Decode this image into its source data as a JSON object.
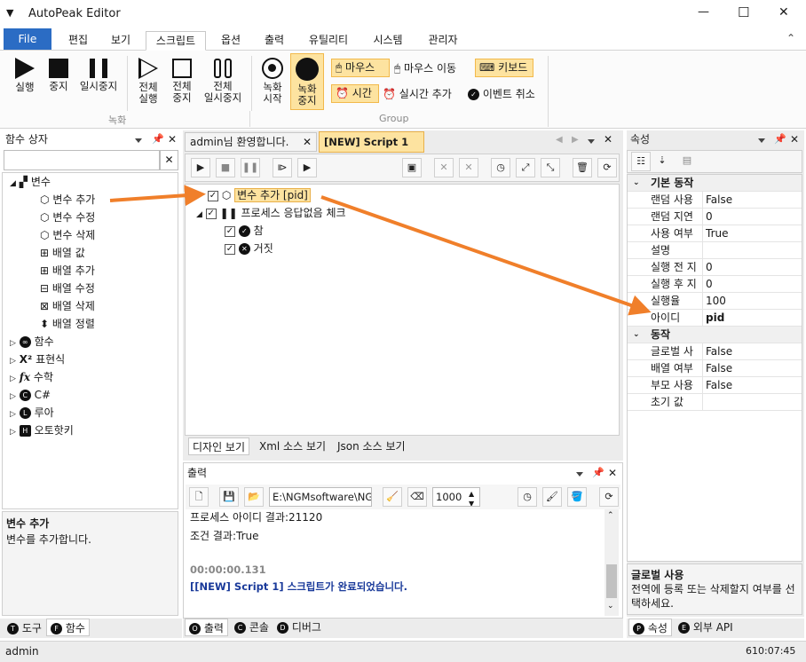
{
  "window": {
    "title": "AutoPeak Editor",
    "min": "—",
    "max": "☐",
    "close": "✕"
  },
  "menu": {
    "file": "File",
    "tabs": [
      "편집",
      "보기",
      "스크립트",
      "옵션",
      "출력",
      "유틸리티",
      "시스템",
      "관리자"
    ],
    "collapse": "⌃"
  },
  "ribbon": {
    "run": "실행",
    "stop": "중지",
    "pause": "일시중지",
    "run_all": [
      "전체",
      "실행"
    ],
    "stop_all": [
      "전체",
      "중지"
    ],
    "pause_all": [
      "전체",
      "일시중지"
    ],
    "rec_start": [
      "녹화",
      "시작"
    ],
    "rec_stop": [
      "녹화",
      "중지"
    ],
    "mouse": "마우스",
    "mouse_move": "마우스 이동",
    "keyboard": "키보드",
    "time": "시간",
    "realtime_add": "실시간 추가",
    "event_cancel": "이벤트 취소",
    "group_rec": "녹화",
    "group_group": "Group"
  },
  "left": {
    "header": "함수 상자",
    "search_value": "",
    "clear": "✕",
    "tree": {
      "var": "변수",
      "var_children": [
        "변수 추가",
        "변수 수정",
        "변수 삭제",
        "배열 값",
        "배열 추가",
        "배열 수정",
        "배열 삭제",
        "배열 정렬"
      ],
      "others": [
        "함수",
        "표현식",
        "수학",
        "C#",
        "루아",
        "오토핫키"
      ]
    },
    "desc_title": "변수 추가",
    "desc_body": "변수를 추가합니다.",
    "bottom_tabs": [
      "도구",
      "함수"
    ],
    "bottom_icons": [
      "T",
      "F"
    ]
  },
  "editor": {
    "tabs": [
      "admin님 환영합니다.",
      "[NEW] Script 1"
    ],
    "script": {
      "row1": "변수 추가 [pid]",
      "row2": "프로세스 응답없음 체크",
      "row3": "참",
      "row4": "거짓"
    },
    "view_tabs": [
      "디자인 보기",
      "Xml 소스 보기",
      "Json 소스 보기"
    ]
  },
  "output": {
    "header": "출력",
    "path": "E:\\NGMsoftware\\NG",
    "number": "1000",
    "lines": [
      "프로세스 아이디 결과:21120",
      "조건 결과:True",
      "",
      "00:00:00.131",
      "[[NEW] Script 1] 스크립트가 완료되었습니다."
    ],
    "bottom_tabs": [
      "출력",
      "콘솔",
      "디버그"
    ],
    "bottom_icons": [
      "O",
      "C",
      "D"
    ]
  },
  "props": {
    "header": "속성",
    "cat1": "기본 동작",
    "rows1": [
      [
        "랜덤 사용",
        "False"
      ],
      [
        "랜덤 지연",
        "0"
      ],
      [
        "사용 여부",
        "True"
      ],
      [
        "설명",
        ""
      ],
      [
        "실행 전 지",
        "0"
      ],
      [
        "실행 후 지",
        "0"
      ],
      [
        "실행율",
        "100"
      ],
      [
        "아이디",
        "pid"
      ]
    ],
    "cat2": "동작",
    "rows2": [
      [
        "글로벌 사",
        "False"
      ],
      [
        "배열 여부",
        "False"
      ],
      [
        "부모 사용",
        "False"
      ],
      [
        "초기 값",
        ""
      ]
    ],
    "desc_title": "글로벌 사용",
    "desc_body": "전역에 등록 또는 삭제할지 여부를 선택하세요.",
    "bottom_tabs": [
      "속성",
      "외부 API"
    ],
    "bottom_icons": [
      "P",
      "E"
    ]
  },
  "status": {
    "user": "admin",
    "time": "610:07:45"
  },
  "colors": {
    "accent": "#2b6cc4",
    "arrow": "#f07f2a",
    "highlight": "#fde3a0"
  }
}
